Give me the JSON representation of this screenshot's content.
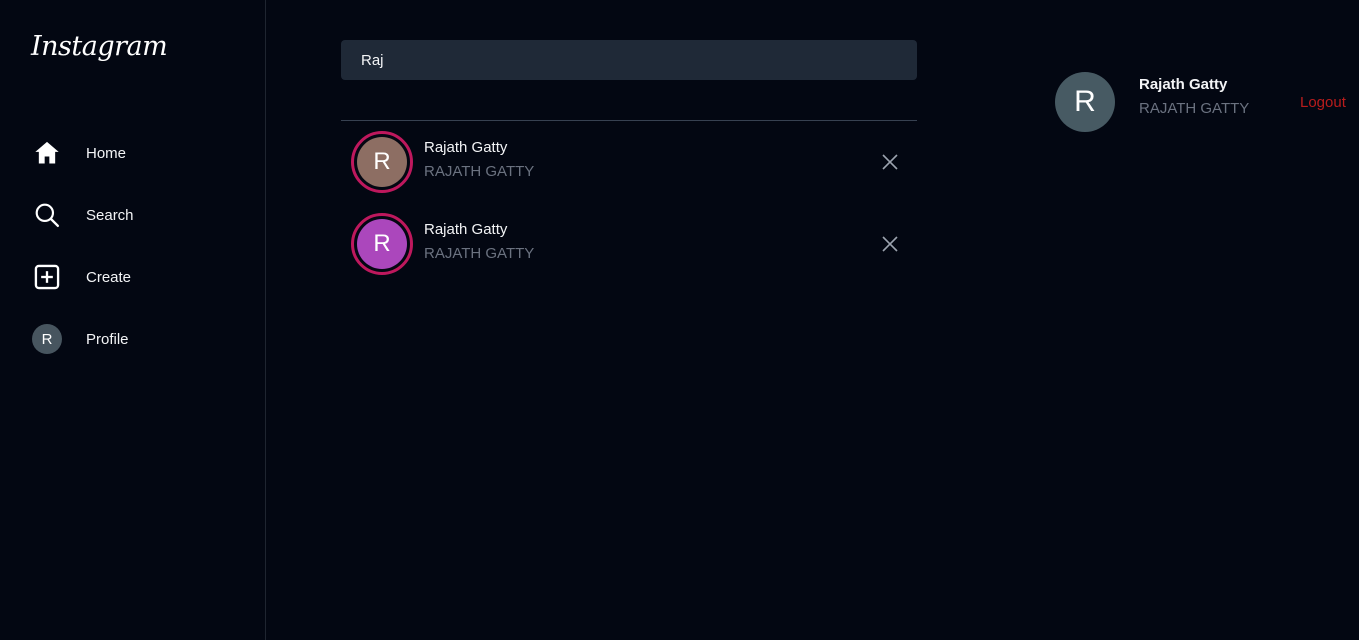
{
  "app": {
    "logo_text": "Instagram"
  },
  "sidebar": {
    "items": [
      {
        "label": "Home",
        "icon": "home-icon"
      },
      {
        "label": "Search",
        "icon": "search-icon"
      },
      {
        "label": "Create",
        "icon": "plus-square-icon"
      },
      {
        "label": "Profile",
        "icon": "avatar",
        "avatar_letter": "R"
      }
    ]
  },
  "search": {
    "value": "Raj"
  },
  "results": [
    {
      "name": "Rajath Gatty",
      "handle": "RAJATH GATTY",
      "avatar_letter": "R",
      "avatar_color": "#8d6e63"
    },
    {
      "name": "Rajath Gatty",
      "handle": "RAJATH GATTY",
      "avatar_letter": "R",
      "avatar_color": "#ab47bc"
    }
  ],
  "current_user": {
    "name": "Rajath Gatty",
    "handle": "RAJATH GATTY",
    "avatar_letter": "R"
  },
  "actions": {
    "logout_label": "Logout"
  },
  "colors": {
    "background": "#030712",
    "story_ring": "#be185d",
    "logout": "#b91c1c"
  }
}
